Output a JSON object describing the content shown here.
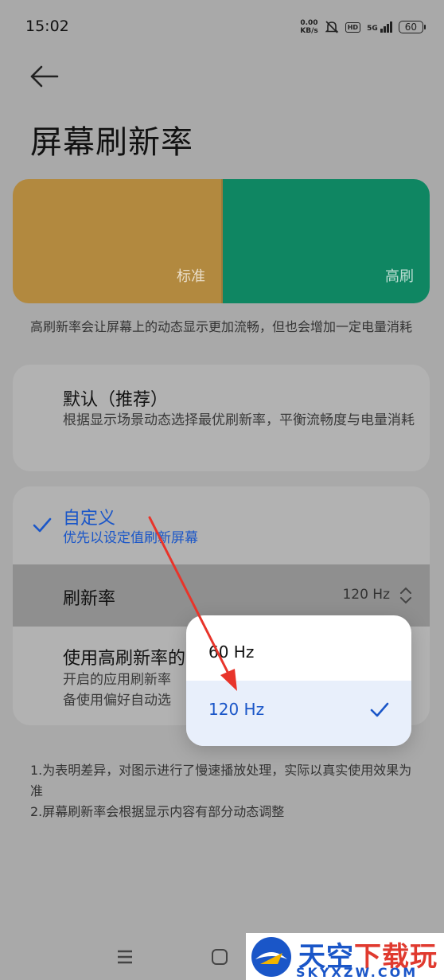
{
  "status_bar": {
    "time": "15:02",
    "net_speed_value": "0.00",
    "net_speed_unit": "KB/s",
    "hd": "HD",
    "network": "5G",
    "battery": "60"
  },
  "header": {
    "back_icon": "arrow-left-icon",
    "title": "屏幕刷新率"
  },
  "preview": {
    "standard_label": "标准",
    "high_label": "高刷",
    "standard_color": "#b2893f",
    "high_color": "#0f8662"
  },
  "description": "高刷新率会让屏幕上的动态显示更加流畅，但也会增加一定电量消耗",
  "options": {
    "default": {
      "title": "默认（推荐）",
      "subtitle": "根据显示场景动态选择最优刷新率，平衡流畅度与电量消耗"
    },
    "custom": {
      "title": "自定义",
      "subtitle": "优先以设定值刷新屏幕",
      "selected": true
    },
    "refresh_rate": {
      "label": "刷新率",
      "value": "120 Hz"
    },
    "apps": {
      "title": "使用高刷新率的",
      "subtitle": "开启的应用刷新率\n备使用偏好自动选"
    }
  },
  "dropdown": {
    "options": [
      "60 Hz",
      "120 Hz"
    ],
    "selected": "120 Hz"
  },
  "notes": [
    "1.为表明差异，对图示进行了慢速播放处理，实际以真实使用效果为准",
    "2.屏幕刷新率会根据显示内容有部分动态调整"
  ],
  "watermark": {
    "brand_a": "天空",
    "brand_b": "下载玩",
    "domain": "SKYXZW.COM"
  },
  "colors": {
    "accent": "#1a56c8",
    "arrow": "#e8342a"
  }
}
